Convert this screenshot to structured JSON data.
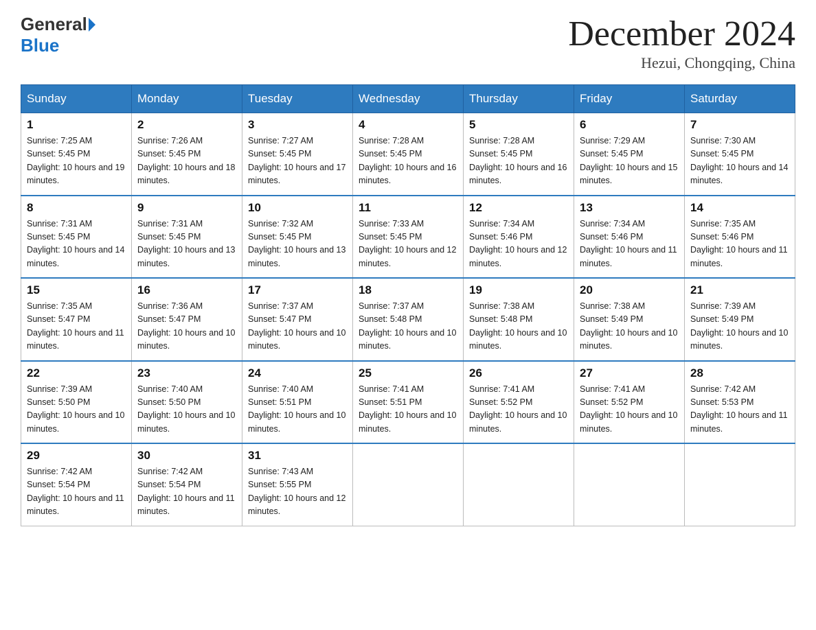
{
  "logo": {
    "general": "General",
    "blue": "Blue"
  },
  "title": "December 2024",
  "subtitle": "Hezui, Chongqing, China",
  "headers": [
    "Sunday",
    "Monday",
    "Tuesday",
    "Wednesday",
    "Thursday",
    "Friday",
    "Saturday"
  ],
  "weeks": [
    [
      {
        "day": "1",
        "sunrise": "7:25 AM",
        "sunset": "5:45 PM",
        "daylight": "10 hours and 19 minutes."
      },
      {
        "day": "2",
        "sunrise": "7:26 AM",
        "sunset": "5:45 PM",
        "daylight": "10 hours and 18 minutes."
      },
      {
        "day": "3",
        "sunrise": "7:27 AM",
        "sunset": "5:45 PM",
        "daylight": "10 hours and 17 minutes."
      },
      {
        "day": "4",
        "sunrise": "7:28 AM",
        "sunset": "5:45 PM",
        "daylight": "10 hours and 16 minutes."
      },
      {
        "day": "5",
        "sunrise": "7:28 AM",
        "sunset": "5:45 PM",
        "daylight": "10 hours and 16 minutes."
      },
      {
        "day": "6",
        "sunrise": "7:29 AM",
        "sunset": "5:45 PM",
        "daylight": "10 hours and 15 minutes."
      },
      {
        "day": "7",
        "sunrise": "7:30 AM",
        "sunset": "5:45 PM",
        "daylight": "10 hours and 14 minutes."
      }
    ],
    [
      {
        "day": "8",
        "sunrise": "7:31 AM",
        "sunset": "5:45 PM",
        "daylight": "10 hours and 14 minutes."
      },
      {
        "day": "9",
        "sunrise": "7:31 AM",
        "sunset": "5:45 PM",
        "daylight": "10 hours and 13 minutes."
      },
      {
        "day": "10",
        "sunrise": "7:32 AM",
        "sunset": "5:45 PM",
        "daylight": "10 hours and 13 minutes."
      },
      {
        "day": "11",
        "sunrise": "7:33 AM",
        "sunset": "5:45 PM",
        "daylight": "10 hours and 12 minutes."
      },
      {
        "day": "12",
        "sunrise": "7:34 AM",
        "sunset": "5:46 PM",
        "daylight": "10 hours and 12 minutes."
      },
      {
        "day": "13",
        "sunrise": "7:34 AM",
        "sunset": "5:46 PM",
        "daylight": "10 hours and 11 minutes."
      },
      {
        "day": "14",
        "sunrise": "7:35 AM",
        "sunset": "5:46 PM",
        "daylight": "10 hours and 11 minutes."
      }
    ],
    [
      {
        "day": "15",
        "sunrise": "7:35 AM",
        "sunset": "5:47 PM",
        "daylight": "10 hours and 11 minutes."
      },
      {
        "day": "16",
        "sunrise": "7:36 AM",
        "sunset": "5:47 PM",
        "daylight": "10 hours and 10 minutes."
      },
      {
        "day": "17",
        "sunrise": "7:37 AM",
        "sunset": "5:47 PM",
        "daylight": "10 hours and 10 minutes."
      },
      {
        "day": "18",
        "sunrise": "7:37 AM",
        "sunset": "5:48 PM",
        "daylight": "10 hours and 10 minutes."
      },
      {
        "day": "19",
        "sunrise": "7:38 AM",
        "sunset": "5:48 PM",
        "daylight": "10 hours and 10 minutes."
      },
      {
        "day": "20",
        "sunrise": "7:38 AM",
        "sunset": "5:49 PM",
        "daylight": "10 hours and 10 minutes."
      },
      {
        "day": "21",
        "sunrise": "7:39 AM",
        "sunset": "5:49 PM",
        "daylight": "10 hours and 10 minutes."
      }
    ],
    [
      {
        "day": "22",
        "sunrise": "7:39 AM",
        "sunset": "5:50 PM",
        "daylight": "10 hours and 10 minutes."
      },
      {
        "day": "23",
        "sunrise": "7:40 AM",
        "sunset": "5:50 PM",
        "daylight": "10 hours and 10 minutes."
      },
      {
        "day": "24",
        "sunrise": "7:40 AM",
        "sunset": "5:51 PM",
        "daylight": "10 hours and 10 minutes."
      },
      {
        "day": "25",
        "sunrise": "7:41 AM",
        "sunset": "5:51 PM",
        "daylight": "10 hours and 10 minutes."
      },
      {
        "day": "26",
        "sunrise": "7:41 AM",
        "sunset": "5:52 PM",
        "daylight": "10 hours and 10 minutes."
      },
      {
        "day": "27",
        "sunrise": "7:41 AM",
        "sunset": "5:52 PM",
        "daylight": "10 hours and 10 minutes."
      },
      {
        "day": "28",
        "sunrise": "7:42 AM",
        "sunset": "5:53 PM",
        "daylight": "10 hours and 11 minutes."
      }
    ],
    [
      {
        "day": "29",
        "sunrise": "7:42 AM",
        "sunset": "5:54 PM",
        "daylight": "10 hours and 11 minutes."
      },
      {
        "day": "30",
        "sunrise": "7:42 AM",
        "sunset": "5:54 PM",
        "daylight": "10 hours and 11 minutes."
      },
      {
        "day": "31",
        "sunrise": "7:43 AM",
        "sunset": "5:55 PM",
        "daylight": "10 hours and 12 minutes."
      },
      null,
      null,
      null,
      null
    ]
  ]
}
